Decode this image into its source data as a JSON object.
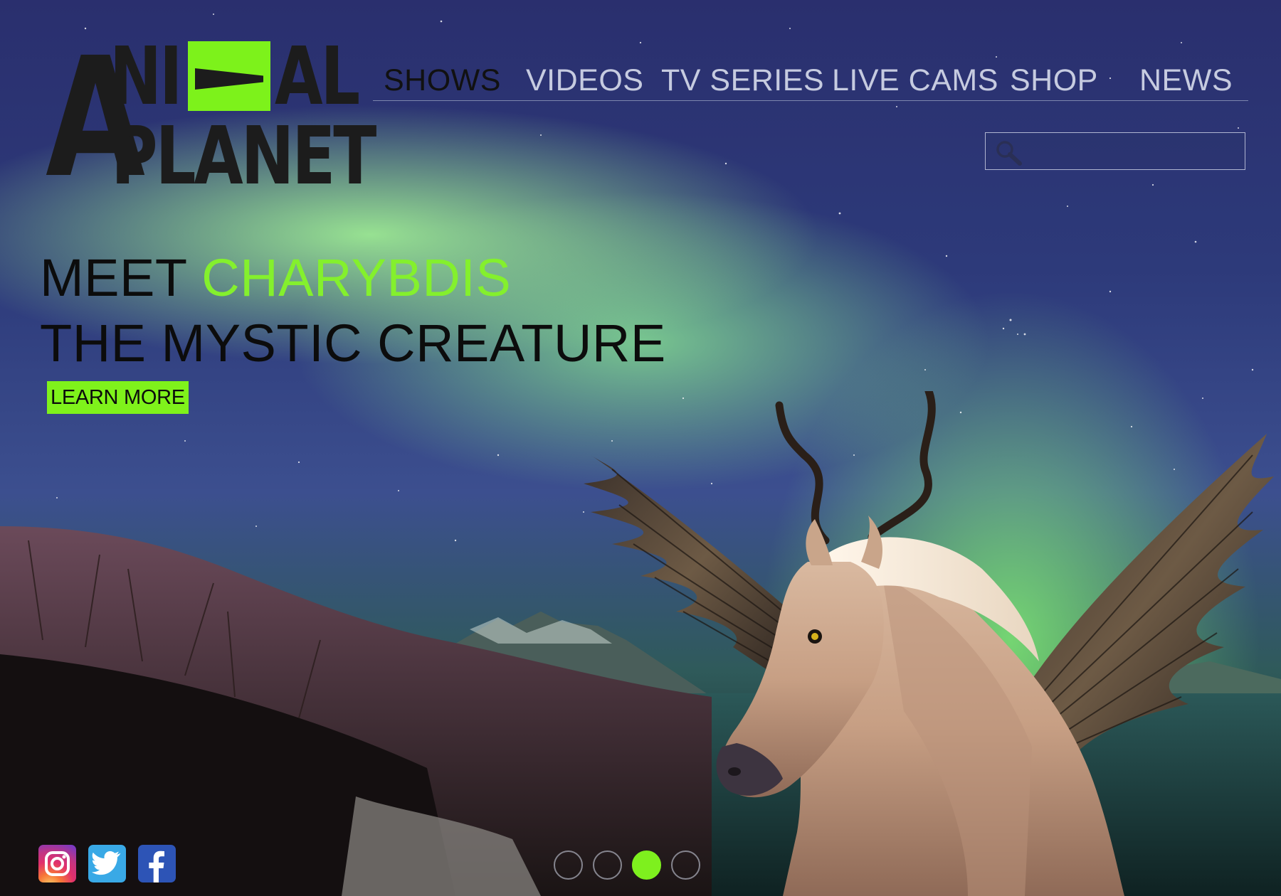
{
  "logo": {
    "big_letter": "A",
    "row1_left": "NI",
    "row1_right": "AL",
    "row2": "PLANET",
    "alt": "ANIMAL PLANET"
  },
  "nav": {
    "items": [
      {
        "label": "SHOWS",
        "active": true
      },
      {
        "label": "VIDEOS",
        "active": false
      },
      {
        "label": "TV SERIES",
        "active": false
      },
      {
        "label": "LIVE CAMS",
        "active": false
      },
      {
        "label": "SHOP",
        "active": false
      },
      {
        "label": "NEWS",
        "active": false
      }
    ]
  },
  "search": {
    "placeholder": "",
    "value": ""
  },
  "hero": {
    "line1_prefix": "MEET ",
    "line1_accent": "CHARYBDIS",
    "line2": "THE MYSTIC CREATURE",
    "cta_label": "LEARN MORE"
  },
  "social": {
    "items": [
      {
        "name": "instagram-icon"
      },
      {
        "name": "twitter-icon"
      },
      {
        "name": "facebook-icon"
      }
    ]
  },
  "carousel": {
    "total_slides": 4,
    "active_slide": 3
  },
  "colors": {
    "accent_green": "#7ff21b",
    "text_dark": "#0c0c0c",
    "nav_inactive": "#c6cbe0"
  }
}
